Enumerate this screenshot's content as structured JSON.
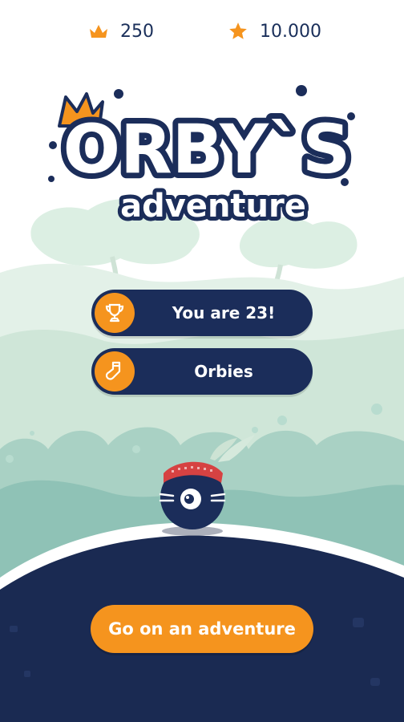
{
  "stats": {
    "crowns": "250",
    "stars": "10.000"
  },
  "title": {
    "main": "ORBY`S",
    "sub": "adventure"
  },
  "menu": {
    "rank_label": "You are 23!",
    "orbies_label": "Orbies"
  },
  "cta": {
    "label": "Go on an adventure"
  },
  "colors": {
    "navy": "#1b2d5a",
    "orange": "#f5941e",
    "foliage_light": "#cfe6d6",
    "foliage_mid": "#a8d0c2",
    "ground": "#1a2a52",
    "headband": "#d64242"
  },
  "icons": [
    "crown-icon",
    "star-icon",
    "trophy-icon",
    "sock-icon"
  ]
}
